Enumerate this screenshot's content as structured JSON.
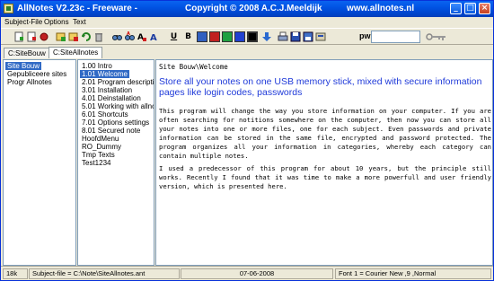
{
  "titlebar": {
    "title": "AllNotes V2.23c - Freeware -",
    "copyright": "Copyright © 2008  A.C.J.Meeldijk",
    "site": "www.allnotes.nl",
    "minimize": "_",
    "maximize": "□",
    "close": "×"
  },
  "menu": [
    "Subject-File",
    "Options",
    "Text"
  ],
  "toolbar": {
    "bold": "B",
    "underline": "U",
    "swatches": [
      "#3060c0",
      "#c02020",
      "#20a040",
      "#2040d0",
      "#000000"
    ],
    "pw_label": "pw"
  },
  "tabs": [
    "C:SiteBouw",
    "C:SiteAllnotes"
  ],
  "categories": {
    "items": [
      "Site Bouw",
      "Gepubliceere sites",
      "Progr Allnotes"
    ],
    "selected_index": 0
  },
  "notes": {
    "items": [
      "1.00 Intro",
      "1.01 Welcome",
      "2.01 Program description",
      "3.01 Installation",
      "4.01 Deinstallation",
      "5.01 Working with allnotes",
      "6.01 Shortcuts",
      "7.01 Options settings",
      "8.01 Secured note",
      "HoofdMenu",
      "RO_Dummy",
      "Tmp Texts",
      "Test1234"
    ],
    "selected_index": 1
  },
  "content": {
    "path": "Site Bouw\\Welcome",
    "heading": "Store all your notes on one USB memory stick, mixed with secure information pages like login codes, passwords",
    "para1": "This program will change the way you store information on your computer. If you are often searching for notitions somewhere on the computer, then now you can store all your notes into one or more files, one for each subject. Even passwords and private information can be stored in the same file, encrypted and password protected. The program organizes all your information in categories, whereby each category can contain multiple notes.",
    "para2": "I used a predecessor of this program for about 10 years, but the principle still works. Recently I found that it was time to make a more powerfull and user friendly version, which is presented here."
  },
  "status": {
    "size": "18k",
    "file": "Subject-file = C:\\Note\\SiteAllnotes.ant",
    "date": "07-06-2008",
    "font": "Font 1 = Courier New ,9 ,Normal"
  }
}
